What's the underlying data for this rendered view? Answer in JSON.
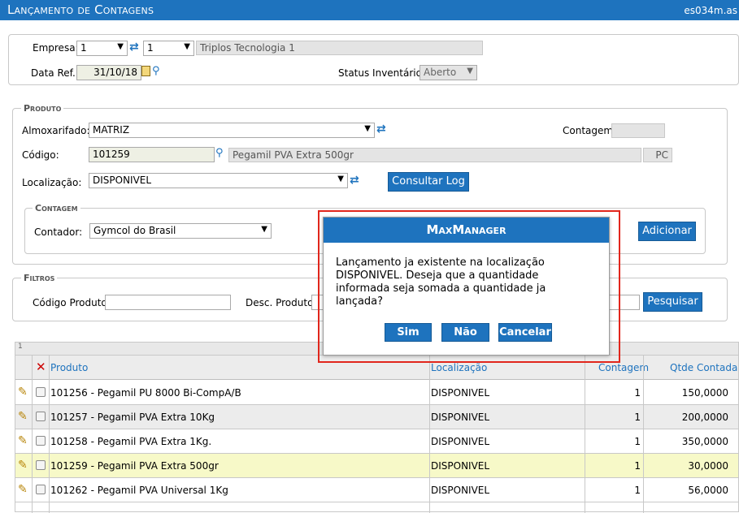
{
  "window": {
    "title": "Lançamento de Contagens",
    "code": "es034m.as"
  },
  "header": {
    "empresa_label": "Empresa:",
    "empresa_value": "1",
    "empresa_value2": "1",
    "empresa_name": "Triplos Tecnologia 1",
    "data_ref_label": "Data Ref.:",
    "data_ref_value": "31/10/18",
    "status_label": "Status Inventário:",
    "status_value": "Aberto"
  },
  "produto": {
    "legend": "Produto",
    "almox_label": "Almoxarifado:",
    "almox_value": "MATRIZ",
    "contagem_label": "Contagem:",
    "contagem_value": "",
    "codigo_label": "Código:",
    "codigo_value": "101259",
    "codigo_desc": "Pegamil PVA Extra 500gr",
    "unidade": "PC",
    "localizacao_label": "Localização:",
    "localizacao_value": "DISPONIVEL",
    "consultar_log": "Consultar Log",
    "contagem_legend": "Contagem",
    "contador_label": "Contador:",
    "contador_value": "Gymcol do Brasil",
    "adicionar": "Adicionar"
  },
  "filtros": {
    "legend": "Filtros",
    "cod_produto_label": "Código Produto:",
    "desc_produto_label": "Desc. Produto:",
    "pesquisar": "Pesquisar"
  },
  "grid": {
    "page": "1",
    "columns": {
      "produto": "Produto",
      "localizacao": "Localização",
      "contagem": "Contagem",
      "qtde": "Qtde Contada"
    },
    "rows": [
      {
        "produto": "101256 - Pegamil PU 8000 Bi-CompA/B",
        "localizacao": "DISPONIVEL",
        "contagem": "1",
        "qtde": "150,0000",
        "highlight": false
      },
      {
        "produto": "101257 - Pegamil PVA Extra 10Kg",
        "localizacao": "DISPONIVEL",
        "contagem": "1",
        "qtde": "200,0000",
        "highlight": false
      },
      {
        "produto": "101258 - Pegamil PVA Extra 1Kg.",
        "localizacao": "DISPONIVEL",
        "contagem": "1",
        "qtde": "350,0000",
        "highlight": false
      },
      {
        "produto": "101259 - Pegamil PVA Extra 500gr",
        "localizacao": "DISPONIVEL",
        "contagem": "1",
        "qtde": "30,0000",
        "highlight": true
      },
      {
        "produto": "101262 - Pegamil PVA Universal 1Kg",
        "localizacao": "DISPONIVEL",
        "contagem": "1",
        "qtde": "56,0000",
        "highlight": false
      }
    ]
  },
  "modal": {
    "title": "MaxManager",
    "message": "Lançamento ja existente na localização DISPONIVEL. Deseja que a quantidade informada seja somada a quantidade ja lançada?",
    "yes": "Sim",
    "no": "Não",
    "cancel": "Cancelar"
  },
  "colors": {
    "accent": "#1e73be",
    "highlight_row": "#f7f9c8",
    "alt_row": "#ececec",
    "outline": "#e1261c"
  }
}
